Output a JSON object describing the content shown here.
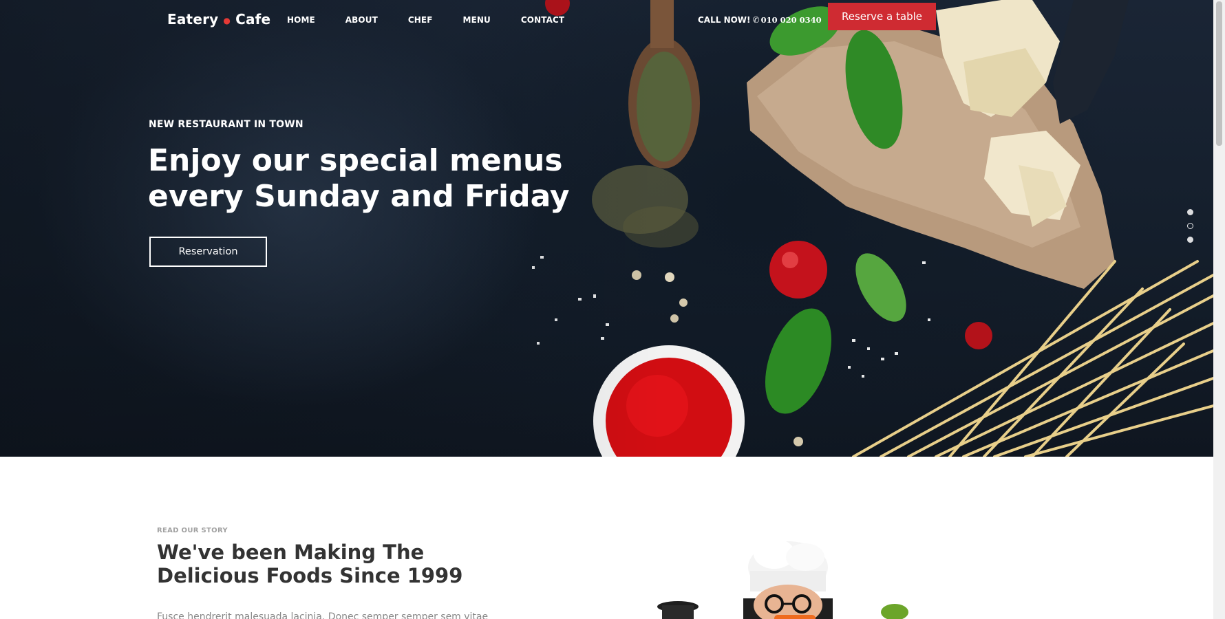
{
  "header": {
    "logo_left": "Eatery",
    "logo_right": "Cafe",
    "nav": [
      "HOME",
      "ABOUT",
      "CHEF",
      "MENU",
      "CONTACT"
    ],
    "call_label": "CALL NOW!",
    "call_number": "010 020 0340",
    "reserve_label": "Reserve a table"
  },
  "hero": {
    "kicker": "NEW RESTAURANT IN TOWN",
    "headline": "Enjoy our special menus every Sunday and Friday",
    "button_label": "Reservation",
    "slide_count": 3,
    "active_slide": 2
  },
  "story": {
    "kicker": "READ OUR STORY",
    "title": "We've been Making The Delicious Foods Since 1999",
    "text": "Fusce hendrerit malesuada lacinia. Donec semper semper sem vitae"
  },
  "colors": {
    "accent": "#cf2b32",
    "hero_bg": "#141e2b",
    "text_dark": "#333333",
    "text_muted": "#888888"
  },
  "icons": [
    "phone-icon"
  ]
}
